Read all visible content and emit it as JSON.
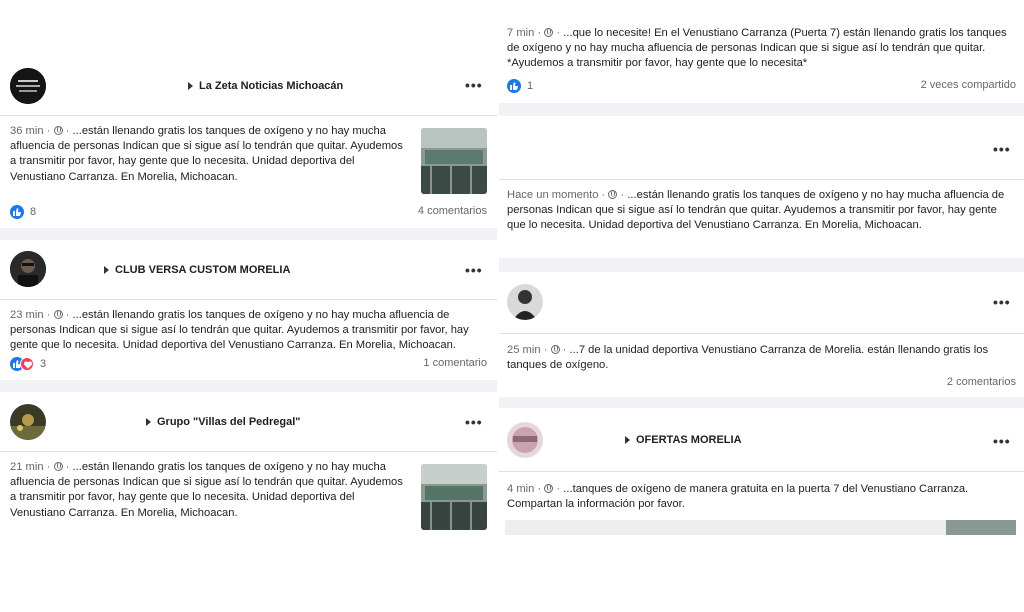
{
  "icons": {
    "like": "thumbs-up-icon",
    "love": "heart-icon",
    "privacy": "globe-icon",
    "more": "more-options-icon",
    "arrow": "caret-right-icon"
  },
  "colors": {
    "like_blue": "#1877f2",
    "love_red": "#f33e58",
    "meta_gray": "#65676b",
    "feed_bg": "#f0f2f5"
  },
  "left_posts": [
    {
      "author": "La Zeta Noticias Michoacán",
      "time": "36 min",
      "dot": "·",
      "text": "...están llenando gratis los tanques de oxígeno y no hay mucha afluencia de personas Indican que si sigue así lo tendrán que quitar. Ayudemos a transmitir por favor, hay gente que lo necesita. Unidad deportiva del Venustiano Carranza. En Morelia, Michoacan.",
      "reactions": "8",
      "comments": "4 comentarios"
    },
    {
      "author": "CLUB VERSA CUSTOM MORELIA",
      "time": "23 min",
      "dot": "·",
      "text": "...están llenando gratis los tanques de oxígeno y no hay mucha afluencia de personas Indican que si sigue así lo tendrán que quitar. Ayudemos a transmitir por favor, hay gente que lo necesita. Unidad deportiva del Venustiano Carranza. En Morelia, Michoacan.",
      "reactions": "3",
      "comments": "1 comentario"
    },
    {
      "author": "Grupo \"Villas del Pedregal\"",
      "time": "21 min",
      "dot": "·",
      "text": "...están llenando gratis los tanques de oxígeno y no hay mucha afluencia de personas Indican que si sigue así lo tendrán que quitar. Ayudemos a transmitir por favor, hay gente que lo necesita. Unidad deportiva del Venustiano Carranza. En Morelia, Michoacan."
    }
  ],
  "right_posts": [
    {
      "time": "7 min",
      "dot": "·",
      "text": "...que lo necesite! En el Venustiano Carranza (Puerta 7) están llenando gratis los tanques de oxígeno y no hay mucha afluencia de personas Indican que si sigue así lo tendrán que quitar. *Ayudemos a transmitir por favor, hay gente que lo necesita*",
      "reactions": "1",
      "shares": "2 veces compartido"
    },
    {
      "time": "Hace un momento",
      "dot": "·",
      "text": "...están llenando gratis los tanques de oxígeno y no hay mucha afluencia de personas Indican que si sigue así lo tendrán que quitar. Ayudemos a transmitir por favor, hay gente que lo necesita. Unidad deportiva del Venustiano Carranza. En Morelia, Michoacan."
    },
    {
      "time": "25 min",
      "dot": "·",
      "text": "...7 de la unidad deportiva Venustiano Carranza de Morelia. están llenando gratis los tanques de oxígeno.",
      "comments": "2 comentarios"
    },
    {
      "author": "OFERTAS MORELIA",
      "time": "4 min",
      "dot": "·",
      "text": "...tanques de oxígeno de manera gratuita en la puerta 7 del Venustiano Carranza. Compartan la información por favor."
    }
  ]
}
